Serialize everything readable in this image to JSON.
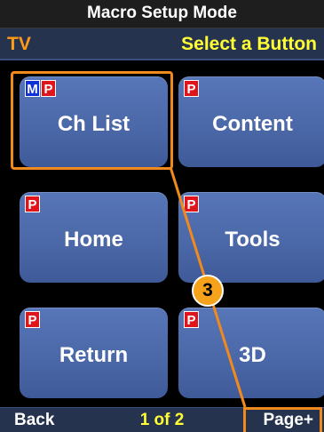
{
  "header": {
    "title": "Macro Setup Mode"
  },
  "subheader": {
    "device": "TV",
    "prompt": "Select a Button"
  },
  "buttons": [
    {
      "label": "Ch List",
      "badges": [
        "M",
        "P"
      ]
    },
    {
      "label": "Content",
      "badges": [
        "P"
      ]
    },
    {
      "label": "Home",
      "badges": [
        "P"
      ]
    },
    {
      "label": "Tools",
      "badges": [
        "P"
      ]
    },
    {
      "label": "Return",
      "badges": [
        "P"
      ]
    },
    {
      "label": "3D",
      "badges": [
        "P"
      ]
    }
  ],
  "callout": {
    "number": "3"
  },
  "footer": {
    "back_label": "Back",
    "page_indicator": "1 of 2",
    "next_label": "Page+"
  },
  "colors": {
    "highlight": "#f08a1d",
    "button_blue": "#4b68a8",
    "badge_p": "#e0141b",
    "badge_m": "#1030d8",
    "accent_yellow": "#ffff33",
    "accent_orange": "#ff9a1a"
  }
}
